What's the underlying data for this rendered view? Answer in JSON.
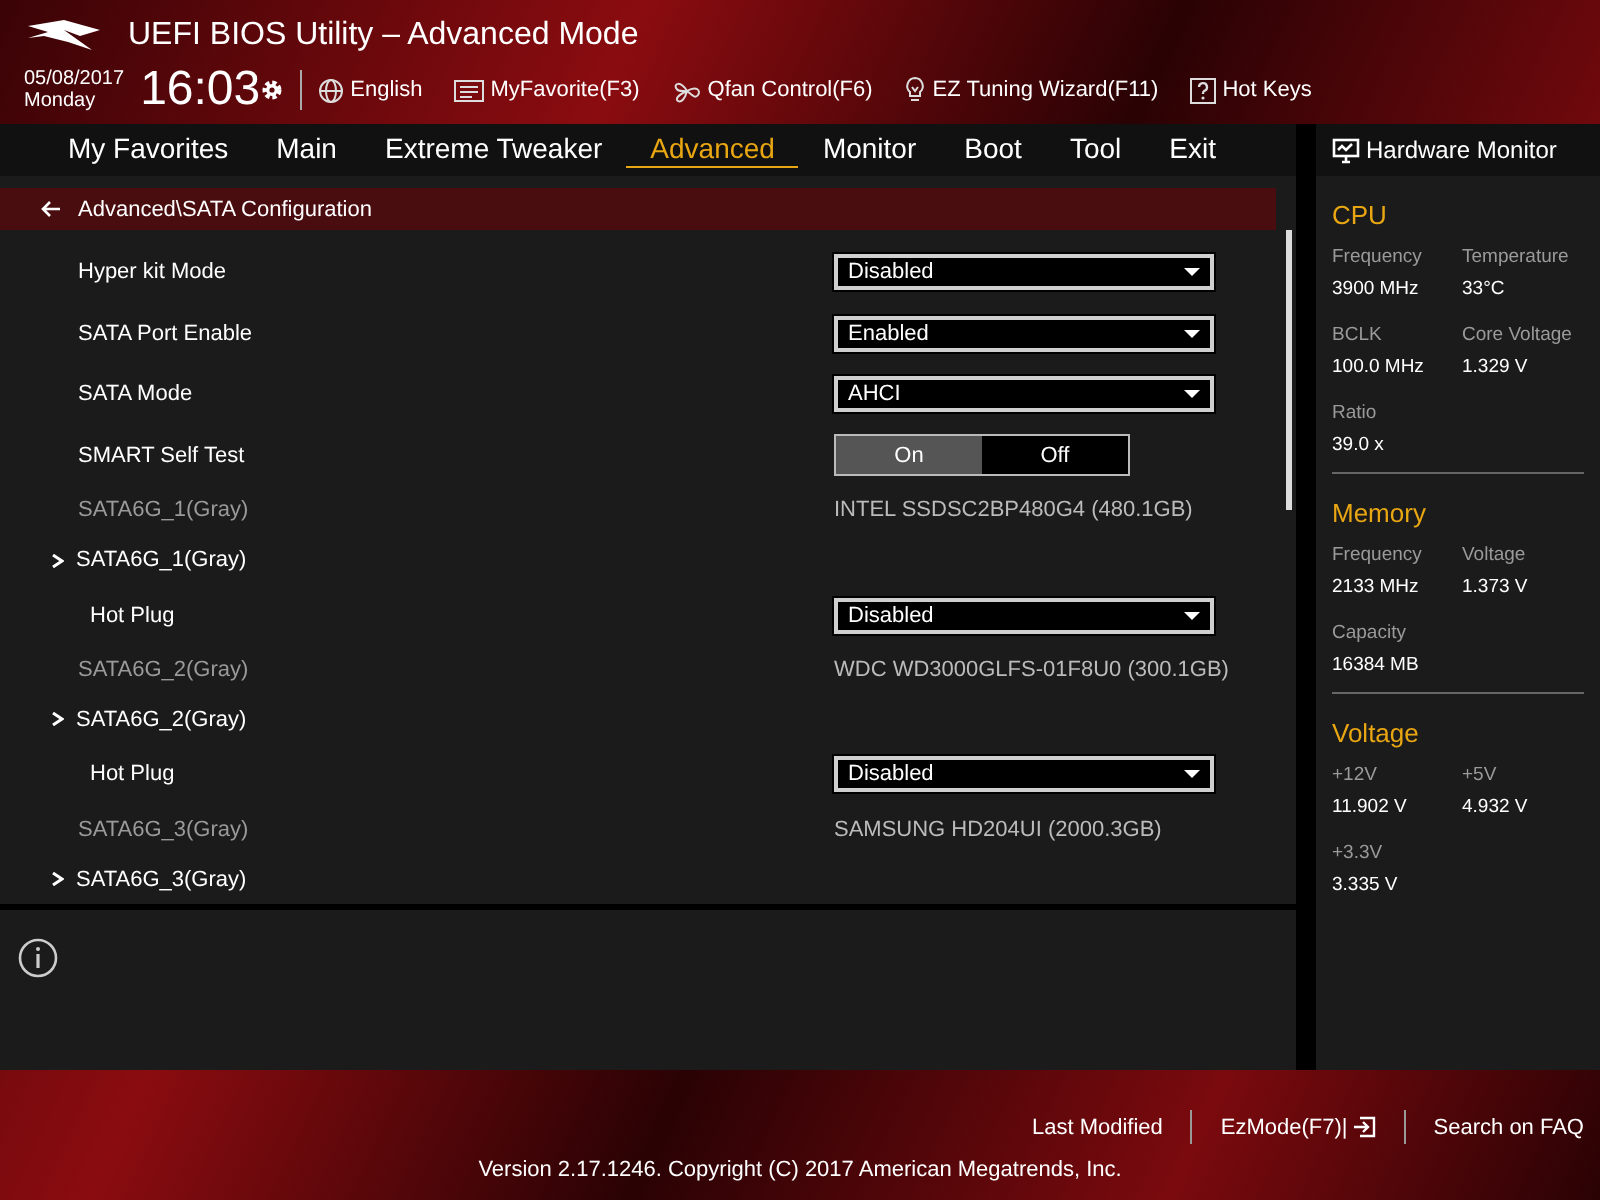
{
  "header": {
    "title": "UEFI BIOS Utility – Advanced Mode",
    "date": "05/08/2017",
    "day": "Monday",
    "time": "16:03",
    "shortcuts": [
      {
        "kind": "globe",
        "label": "English"
      },
      {
        "kind": "favorite",
        "label": "MyFavorite(F3)"
      },
      {
        "kind": "fan",
        "label": "Qfan Control(F6)"
      },
      {
        "kind": "bulb",
        "label": "EZ Tuning Wizard(F11)"
      },
      {
        "kind": "help",
        "label": "Hot Keys"
      }
    ]
  },
  "tabs": [
    {
      "label": "My Favorites",
      "selected": false
    },
    {
      "label": "Main",
      "selected": false
    },
    {
      "label": "Extreme Tweaker",
      "selected": false
    },
    {
      "label": "Advanced",
      "selected": true
    },
    {
      "label": "Monitor",
      "selected": false
    },
    {
      "label": "Boot",
      "selected": false
    },
    {
      "label": "Tool",
      "selected": false
    },
    {
      "label": "Exit",
      "selected": false
    }
  ],
  "breadcrumb": "Advanced\\SATA Configuration",
  "settings": [
    {
      "kind": "dropdown",
      "label": "Hyper kit Mode",
      "value": "Disabled"
    },
    {
      "kind": "dropdown",
      "label": "SATA Port Enable",
      "value": "Enabled"
    },
    {
      "kind": "dropdown",
      "label": "SATA Mode",
      "value": "AHCI"
    },
    {
      "kind": "toggle",
      "label": "SMART Self Test",
      "options": [
        {
          "label": "On",
          "selected": true
        },
        {
          "label": "Off",
          "selected": false
        }
      ]
    },
    {
      "kind": "info",
      "label": "SATA6G_1(Gray)",
      "value": "INTEL SSDSC2BP480G4 (480.1GB)"
    },
    {
      "kind": "submenu",
      "label": "SATA6G_1(Gray)",
      "children": [
        {
          "kind": "dropdown",
          "label": "Hot Plug",
          "value": "Disabled"
        }
      ]
    },
    {
      "kind": "info",
      "label": "SATA6G_2(Gray)",
      "value": "WDC WD3000GLFS-01F8U0 (300.1GB)"
    },
    {
      "kind": "submenu",
      "label": "SATA6G_2(Gray)",
      "children": [
        {
          "kind": "dropdown",
          "label": "Hot Plug",
          "value": "Disabled"
        }
      ]
    },
    {
      "kind": "info",
      "label": "SATA6G_3(Gray)",
      "value": "SAMSUNG HD204UI (2000.3GB)"
    },
    {
      "kind": "submenu",
      "label": "SATA6G_3(Gray)"
    }
  ],
  "hardware_monitor": {
    "title": "Hardware Monitor",
    "sections": [
      {
        "title": "CPU",
        "items": [
          {
            "label": "Frequency",
            "value": "3900 MHz"
          },
          {
            "label": "Temperature",
            "value": "33°C"
          },
          {
            "label": "BCLK",
            "value": "100.0 MHz"
          },
          {
            "label": "Core Voltage",
            "value": "1.329 V"
          },
          {
            "label": "Ratio",
            "value": "39.0 x"
          }
        ]
      },
      {
        "title": "Memory",
        "items": [
          {
            "label": "Frequency",
            "value": "2133 MHz"
          },
          {
            "label": "Voltage",
            "value": "1.373 V"
          },
          {
            "label": "Capacity",
            "value": "16384 MB"
          }
        ]
      },
      {
        "title": "Voltage",
        "items": [
          {
            "label": "+12V",
            "value": "11.902 V"
          },
          {
            "label": "+5V",
            "value": "4.932 V"
          },
          {
            "label": "+3.3V",
            "value": "3.335 V"
          }
        ]
      }
    ]
  },
  "footer": {
    "links": [
      {
        "kind": "plain",
        "label": "Last Modified"
      },
      {
        "kind": "exit",
        "label": "EzMode(F7)|"
      },
      {
        "kind": "plain",
        "label": "Search on FAQ"
      }
    ],
    "version": "Version 2.17.1246. Copyright (C) 2017 American Megatrends, Inc."
  }
}
